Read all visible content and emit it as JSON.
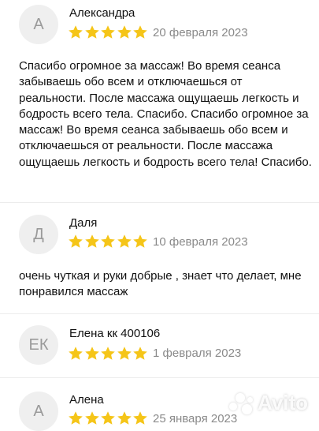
{
  "colors": {
    "star": "#f5c518",
    "avatar_bg": "#efefef",
    "avatar_text": "#9a9a9a",
    "date": "#8a8a8a"
  },
  "reviews": [
    {
      "initials": "А",
      "name": "Александра",
      "rating": 5,
      "date": "20 февраля 2023",
      "text": "Спасибо огромное за массаж! Во время сеанса забываешь обо всем и отключаешься от реальности. После массажа ощущаешь легкость и бодрость всего тела. Спасибо. Спасибо огромное за массаж! Во время сеанса забываешь обо всем и отключаешься от реальности. После массажа ощущаешь легкость и бодрость всего тела! Спасибо."
    },
    {
      "initials": "Д",
      "name": "Даля",
      "rating": 5,
      "date": "10 февраля 2023",
      "text": "очень чуткая и руки добрые , знает что делает, мне понравился массаж"
    },
    {
      "initials": "ЕК",
      "name": "Елена кк 400106",
      "rating": 5,
      "date": "1 февраля 2023",
      "text": ""
    },
    {
      "initials": "А",
      "name": "Алена",
      "rating": 5,
      "date": "25 января 2023",
      "text": ""
    }
  ],
  "watermark": {
    "text": "Avito",
    "icon": "avito-logo-icon"
  }
}
